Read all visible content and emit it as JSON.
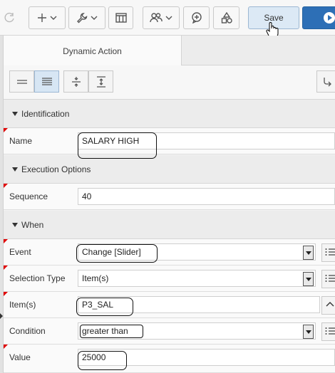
{
  "toolbar": {
    "save_label": "Save",
    "buttons": [
      {
        "name": "undo-button",
        "icon": "undo-icon"
      },
      {
        "name": "create-menu-button",
        "icon": "plus-icon"
      },
      {
        "name": "utilities-menu-button",
        "icon": "wrench-icon"
      },
      {
        "name": "layout-button",
        "icon": "table-icon"
      },
      {
        "name": "shared-components-button",
        "icon": "users-icon"
      },
      {
        "name": "comments-button",
        "icon": "comment-icon"
      },
      {
        "name": "shapes-button",
        "icon": "shapes-icon"
      },
      {
        "name": "run-button",
        "icon": "play-icon"
      }
    ]
  },
  "tab": {
    "label": "Dynamic Action"
  },
  "sections": {
    "identification": "Identification",
    "execution": "Execution Options",
    "when": "When"
  },
  "fields": {
    "name": {
      "label": "Name",
      "value": "SALARY HIGH"
    },
    "sequence": {
      "label": "Sequence",
      "value": "40"
    },
    "event": {
      "label": "Event",
      "value": "Change [Slider]"
    },
    "selection_type": {
      "label": "Selection Type",
      "value": "Item(s)"
    },
    "items": {
      "label": "Item(s)",
      "value": "P3_SAL"
    },
    "condition": {
      "label": "Condition",
      "value": "greater than"
    },
    "value": {
      "label": "Value",
      "value": "25000"
    }
  },
  "colors": {
    "accent": "#2d6fb6",
    "required_marker": "#e00000",
    "save_bg": "#dce9f5"
  }
}
